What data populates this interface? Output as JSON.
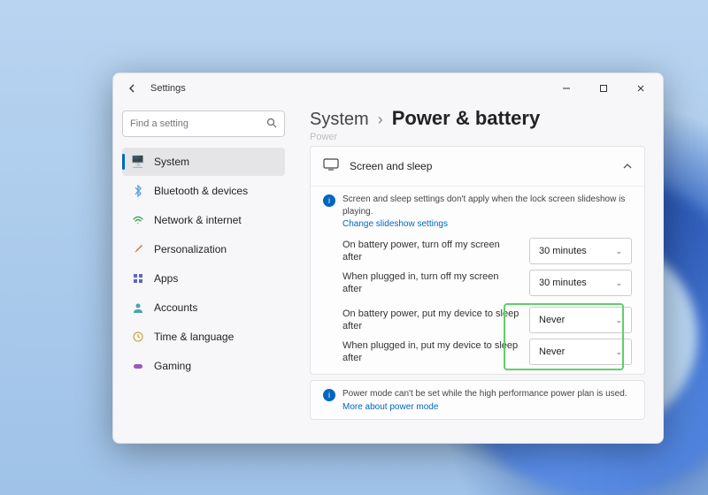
{
  "app": {
    "title": "Settings"
  },
  "search": {
    "placeholder": "Find a setting"
  },
  "nav": [
    {
      "label": "System",
      "icon": "🖥️",
      "color": "#3a78d6"
    },
    {
      "label": "Bluetooth & devices",
      "icon": "●",
      "color": "#4aa3e0"
    },
    {
      "label": "Network & internet",
      "icon": "📶",
      "color": "#3aa655"
    },
    {
      "label": "Personalization",
      "icon": "🎨",
      "color": "#d66a3a"
    },
    {
      "label": "Apps",
      "icon": "▦",
      "color": "#5a6ab8"
    },
    {
      "label": "Accounts",
      "icon": "👤",
      "color": "#4aa3a3"
    },
    {
      "label": "Time & language",
      "icon": "🕒",
      "color": "#caa84a"
    },
    {
      "label": "Gaming",
      "icon": "🎮",
      "color": "#9a5ab8"
    }
  ],
  "breadcrumb": {
    "parent": "System",
    "current": "Power & battery"
  },
  "truncated_section": "Power",
  "card": {
    "title": "Screen and sleep",
    "info1": {
      "text": "Screen and sleep settings don't apply when the lock screen slideshow is playing.",
      "link": "Change slideshow settings"
    },
    "settings": [
      {
        "label": "On battery power, turn off my screen after",
        "value": "30 minutes"
      },
      {
        "label": "When plugged in, turn off my screen after",
        "value": "30 minutes"
      },
      {
        "label": "On battery power, put my device to sleep after",
        "value": "Never"
      },
      {
        "label": "When plugged in, put my device to sleep after",
        "value": "Never"
      }
    ]
  },
  "card2": {
    "text": "Power mode can't be set while the high performance power plan is used.",
    "link": "More about power mode"
  }
}
